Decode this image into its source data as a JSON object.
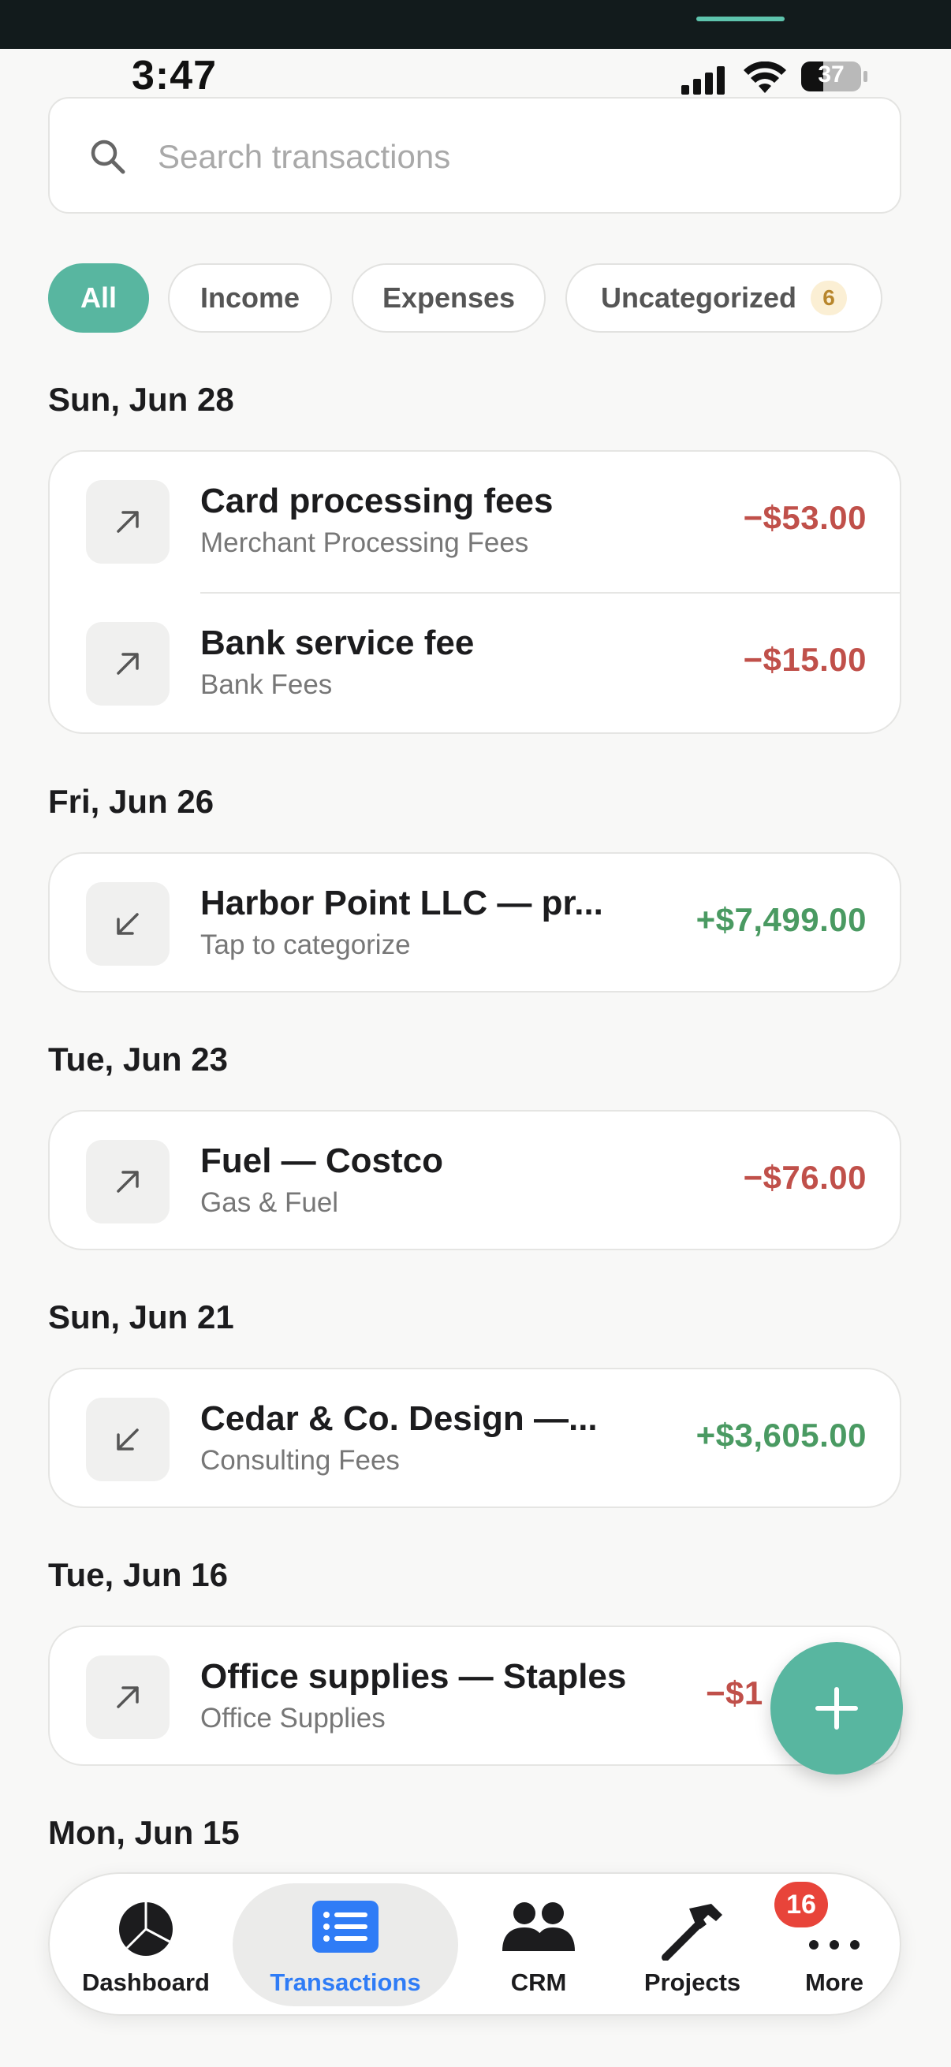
{
  "status_bar": {
    "time": "3:47",
    "battery": "37"
  },
  "search": {
    "placeholder": "Search transactions"
  },
  "filters": [
    {
      "label": "All",
      "active": true
    },
    {
      "label": "Income",
      "active": false
    },
    {
      "label": "Expenses",
      "active": false
    },
    {
      "label": "Uncategorized",
      "active": false,
      "count": "6"
    }
  ],
  "groups": [
    {
      "date": "Sun, Jun 28",
      "transactions": [
        {
          "title": "Card processing fees",
          "category": "Merchant Processing Fees",
          "amount": "−$53.00",
          "direction": "outgoing"
        },
        {
          "title": "Bank service fee",
          "category": "Bank Fees",
          "amount": "−$15.00",
          "direction": "outgoing"
        }
      ]
    },
    {
      "date": "Fri, Jun 26",
      "transactions": [
        {
          "title": "Harbor Point LLC — pr...",
          "category": "Tap to categorize",
          "amount": "+$7,499.00",
          "direction": "incoming"
        }
      ]
    },
    {
      "date": "Tue, Jun 23",
      "transactions": [
        {
          "title": "Fuel — Costco",
          "category": "Gas & Fuel",
          "amount": "−$76.00",
          "direction": "outgoing"
        }
      ]
    },
    {
      "date": "Sun, Jun 21",
      "transactions": [
        {
          "title": "Cedar & Co. Design —...",
          "category": "Consulting Fees",
          "amount": "+$3,605.00",
          "direction": "incoming"
        }
      ]
    },
    {
      "date": "Tue, Jun 16",
      "transactions": [
        {
          "title": "Office supplies — Staples",
          "category": "Office Supplies",
          "amount": "−$1",
          "direction": "outgoing"
        }
      ]
    },
    {
      "date": "Mon, Jun 15",
      "transactions": []
    }
  ],
  "tab_bar": {
    "tabs": [
      {
        "label": "Dashboard",
        "icon": "pie-chart-icon",
        "active": false
      },
      {
        "label": "Transactions",
        "icon": "list-icon",
        "active": true
      },
      {
        "label": "CRM",
        "icon": "people-icon",
        "active": false
      },
      {
        "label": "Projects",
        "icon": "hammer-icon",
        "active": false
      },
      {
        "label": "More",
        "icon": "ellipsis-icon",
        "active": false,
        "badge": "16"
      }
    ]
  },
  "colors": {
    "accent": "#58b6a0",
    "negative": "#c0504a",
    "positive": "#4a9a62",
    "active_tab": "#2f7cf6",
    "badge": "#e8443a"
  }
}
